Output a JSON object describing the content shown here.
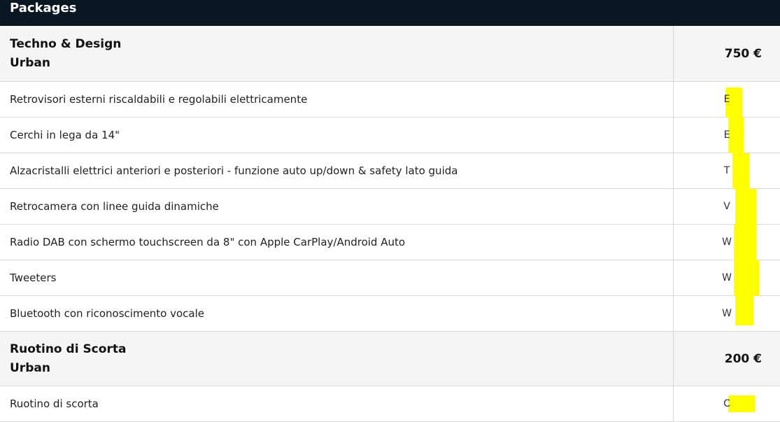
{
  "header": {
    "title": "Packages"
  },
  "packages": [
    {
      "title": "Techno & Design",
      "subtitle": "Urban",
      "price": "750 €",
      "items": [
        {
          "label": "Retrovisori esterni riscaldabili e regolabili elettricamente",
          "code": "E"
        },
        {
          "label": "Cerchi in lega da 14\"",
          "code": "E"
        },
        {
          "label": "Alzacristalli elettrici anteriori e posteriori - funzione auto up/down & safety lato guida",
          "code": "T"
        },
        {
          "label": "Retrocamera con linee guida dinamiche",
          "code": "V"
        },
        {
          "label": "Radio DAB con schermo touchscreen da 8\" con Apple CarPlay/Android Auto",
          "code": "W"
        },
        {
          "label": "Tweeters",
          "code": "W"
        },
        {
          "label": "Bluetooth con riconoscimento vocale",
          "code": "W"
        }
      ]
    },
    {
      "title": "Ruotino di Scorta",
      "subtitle": "Urban",
      "price": "200 €",
      "items": [
        {
          "label": "Ruotino di scorta",
          "code": "C"
        }
      ]
    }
  ],
  "colors": {
    "header_bg": "#0b1623",
    "highlight": "#ffff00"
  }
}
